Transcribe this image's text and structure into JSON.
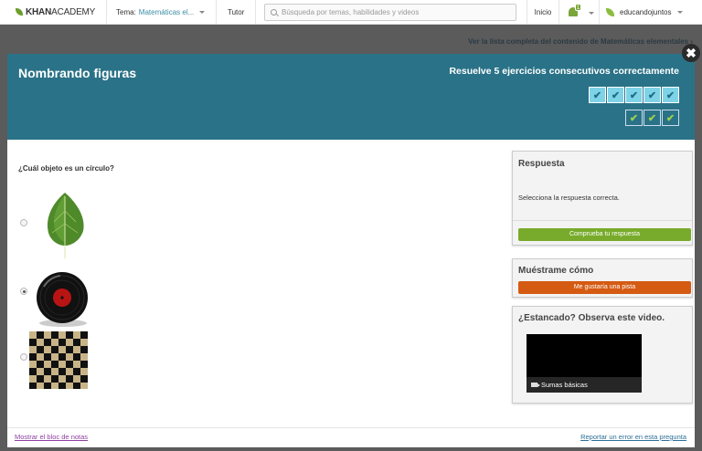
{
  "nav": {
    "logo_khan": "KHAN",
    "logo_academy": "ACADEMY",
    "tema_label": "Tema:",
    "tema_value": "Matemáticas el...",
    "tutor": "Tutor",
    "search_placeholder": "Búsqueda por temas, habilidades y videos",
    "inicio": "Inicio",
    "notifications_count": "1",
    "username": "educandojuntos"
  },
  "breadcrumb": "Ver la lista completa del contenido de Matemáticas elementales ›",
  "exercise": {
    "title": "Nombrando figuras",
    "goal": "Resuelve 5 ejercicios consecutivos correctamente",
    "question": "¿Cuál objeto es un círculo?",
    "options": [
      {
        "icon": "leaf-image",
        "selected": false
      },
      {
        "icon": "vinyl-record-image",
        "selected": true
      },
      {
        "icon": "checkerboard-image",
        "selected": false
      }
    ]
  },
  "answer_panel": {
    "heading": "Respuesta",
    "instruction": "Selecciona la respuesta correcta.",
    "check_button": "Comprueba tu respuesta"
  },
  "hint_panel": {
    "heading": "Muéstrame cómo",
    "hint_button": "Me gustaría una pista"
  },
  "video_panel": {
    "heading": "¿Estancado? Observa este video.",
    "video_title": "Sumas básicas"
  },
  "footer": {
    "notes_link": "Mostrar el bloc de notas",
    "report_link": "Reportar un error en esta pregunta"
  },
  "colors": {
    "header_bg": "#2a7287",
    "check_green": "#78ab2b",
    "hint_orange": "#d55a12"
  }
}
